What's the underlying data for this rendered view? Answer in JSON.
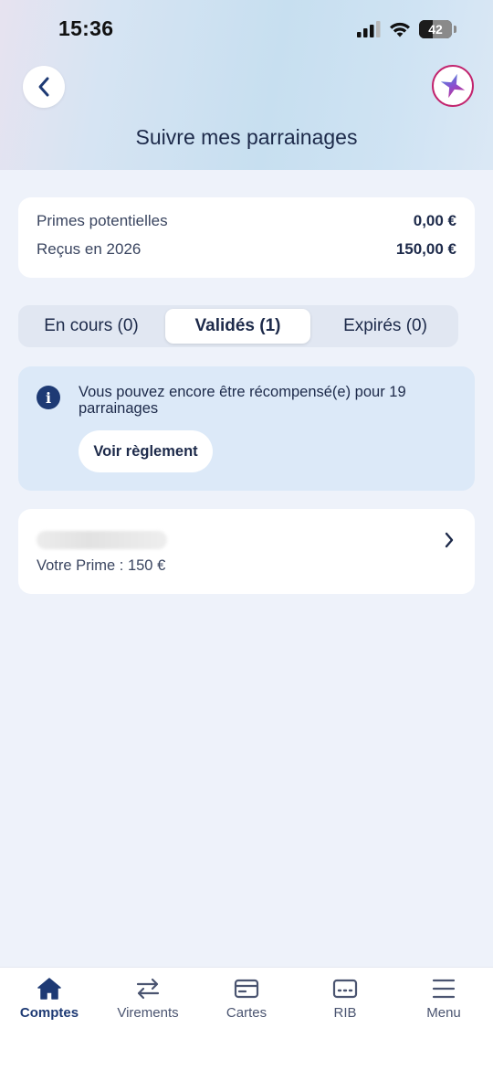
{
  "status_bar": {
    "time": "15:36",
    "battery": "42"
  },
  "header": {
    "title": "Suivre mes parrainages"
  },
  "summary": {
    "rows": [
      {
        "label": "Primes potentielles",
        "value": "0,00 €"
      },
      {
        "label": "Reçus en 2026",
        "value": "150,00 €"
      }
    ]
  },
  "tabs": [
    {
      "label": "En cours (0)",
      "active": false
    },
    {
      "label": "Validés (1)",
      "active": true
    },
    {
      "label": "Expirés (0)",
      "active": false
    }
  ],
  "info": {
    "text": "Vous pouvez encore être récompensé(e) pour 19 parrainages",
    "button_label": "Voir règlement"
  },
  "referrals": [
    {
      "prime": "Votre Prime : 150 €"
    }
  ],
  "bottom_nav": [
    {
      "label": "Comptes",
      "icon": "home-icon",
      "active": true
    },
    {
      "label": "Virements",
      "icon": "transfer-icon",
      "active": false
    },
    {
      "label": "Cartes",
      "icon": "card-icon",
      "active": false
    },
    {
      "label": "RIB",
      "icon": "rib-icon",
      "active": false
    },
    {
      "label": "Menu",
      "icon": "menu-icon",
      "active": false
    }
  ],
  "colors": {
    "primary": "#1e3a74",
    "brand_accent": "#c2246e",
    "background": "#eef2fa",
    "info_bg": "#dce9f8"
  }
}
